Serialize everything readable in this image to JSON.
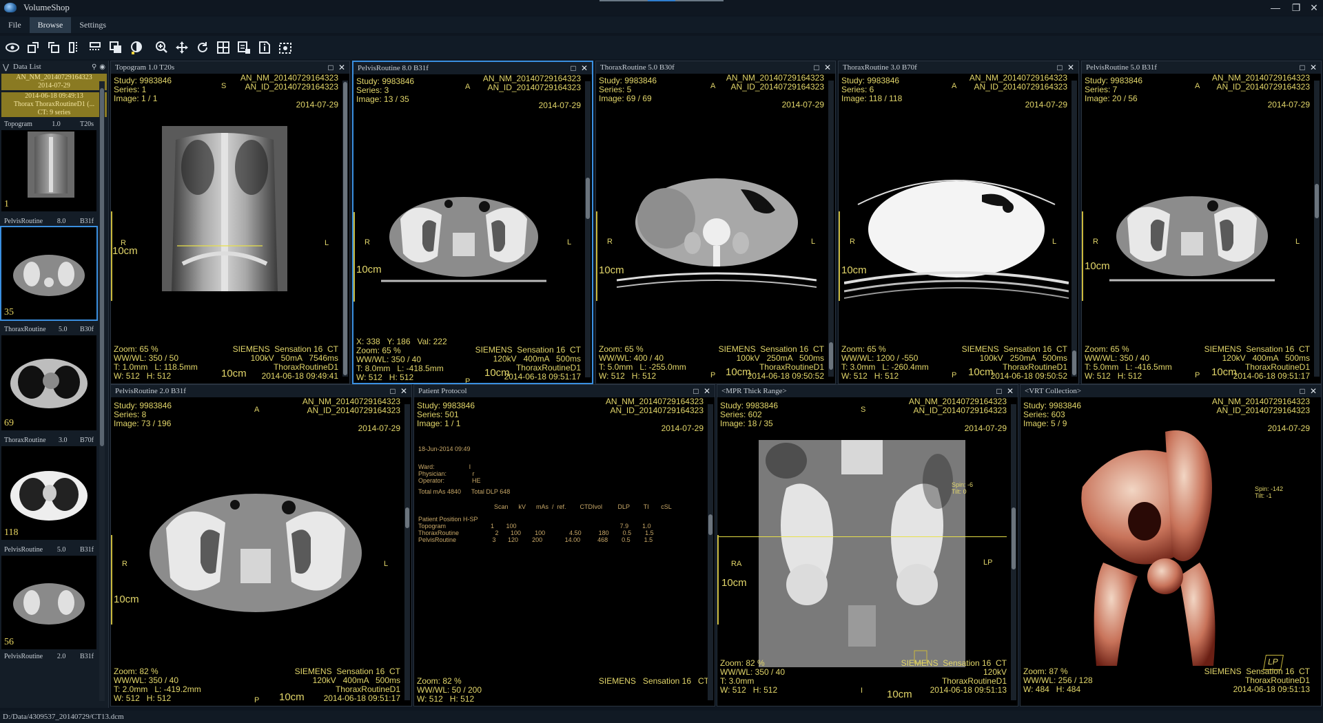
{
  "app": {
    "title": "VolumeShop"
  },
  "menu": {
    "items": [
      "File",
      "Browse",
      "Settings"
    ],
    "active": "Browse"
  },
  "toolbar": {
    "tools": [
      "eye-icon",
      "rotate-icon",
      "flip-icon",
      "mirror-icon",
      "slice-icon",
      "layers-icon",
      "contrast-icon",
      "zoom-icon",
      "pan-icon",
      "reset-icon",
      "grid-icon",
      "export-icon",
      "info-icon",
      "capture-icon"
    ]
  },
  "sidebar": {
    "title": "Data List",
    "study": {
      "id": "AN_NM_20140729164323",
      "date": "2014-07-29",
      "series_time": "2014-06-18 09:49:13",
      "desc": "Thorax ThoraxRoutineD1 (...",
      "count": "CT: 9 series"
    },
    "series": [
      {
        "name": "Topogram",
        "thick": "1.0",
        "kernel": "T20s",
        "count": "1"
      },
      {
        "name": "PelvisRoutine",
        "thick": "8.0",
        "kernel": "B31f",
        "count": "35"
      },
      {
        "name": "ThoraxRoutine",
        "thick": "5.0",
        "kernel": "B30f",
        "count": "69"
      },
      {
        "name": "ThoraxRoutine",
        "thick": "3.0",
        "kernel": "B70f",
        "count": "118"
      },
      {
        "name": "PelvisRoutine",
        "thick": "5.0",
        "kernel": "B31f",
        "count": "56"
      },
      {
        "name": "PelvisRoutine",
        "thick": "2.0",
        "kernel": "B31f",
        "count": ""
      }
    ]
  },
  "viewports": {
    "v1": {
      "title": "Topogram   1.0   T20s",
      "tl": "Study: 9983846\nSeries: 1\nImage: 1 / 1",
      "tr": "AN_NM_20140729164323\nAN_ID_20140729164323\n\n2014-07-29",
      "top": "S",
      "left": "R",
      "right": "L",
      "scale": "10cm",
      "bl": "Zoom: 65 %\nWW/WL: 350 / 50\nT: 1.0mm   L: 118.5mm\nW: 512   H: 512",
      "br": "SIEMENS  Sensation 16  CT\n100kV   50mA   7546ms\nThoraxRoutineD1\n2014-06-18 09:49:41",
      "bscale": "10cm"
    },
    "v2": {
      "title": "PelvisRoutine   8.0   B31f",
      "tl": "Study: 9983846\nSeries: 3\nImage: 13 / 35",
      "tr": "AN_NM_20140729164323\nAN_ID_20140729164323\n\n2014-07-29",
      "top": "A",
      "left": "R",
      "right": "L",
      "bottom": "P",
      "scale": "10cm",
      "bl": "X: 338   Y: 186   Val: 222\nZoom: 65 %\nWW/WL: 350 / 40\nT: 8.0mm   L: -418.5mm\nW: 512   H: 512",
      "br": "SIEMENS  Sensation 16  CT\n120kV   400mA   500ms\nThoraxRoutineD1\n2014-06-18 09:51:17",
      "bscale": "10cm"
    },
    "v3": {
      "title": "ThoraxRoutine   5.0   B30f",
      "tl": "Study: 9983846\nSeries: 5\nImage: 69 / 69",
      "tr": "AN_NM_20140729164323\nAN_ID_20140729164323\n\n2014-07-29",
      "top": "A",
      "left": "R",
      "right": "L",
      "bottom": "P",
      "scale": "10cm",
      "bl": "Zoom: 65 %\nWW/WL: 400 / 40\nT: 5.0mm   L: -255.0mm\nW: 512   H: 512",
      "br": "SIEMENS  Sensation 16  CT\n100kV   250mA   500ms\nThoraxRoutineD1\n2014-06-18 09:50:52",
      "bscale": "10cm"
    },
    "v4": {
      "title": "ThoraxRoutine   3.0   B70f",
      "tl": "Study: 9983846\nSeries: 6\nImage: 118 / 118",
      "tr": "AN_NM_20140729164323\nAN_ID_20140729164323\n\n2014-07-29",
      "top": "A",
      "left": "R",
      "right": "L",
      "bottom": "P",
      "scale": "10cm",
      "bl": "Zoom: 65 %\nWW/WL: 1200 / -550\nT: 3.0mm   L: -260.4mm\nW: 512   H: 512",
      "br": "SIEMENS  Sensation 16  CT\n100kV   250mA   500ms\nThoraxRoutineD1\n2014-06-18 09:50:52",
      "bscale": "10cm"
    },
    "v5": {
      "title": "PelvisRoutine   5.0   B31f",
      "tl": "Study: 9983846\nSeries: 7\nImage: 20 / 56",
      "tr": "AN_NM_20140729164323\nAN_ID_20140729164323\n\n2014-07-29",
      "top": "A",
      "left": "R",
      "right": "L",
      "bottom": "P",
      "scale": "10cm",
      "bl": "Zoom: 65 %\nWW/WL: 350 / 40\nT: 5.0mm   L: -416.5mm\nW: 512   H: 512",
      "br": "SIEMENS  Sensation 16  CT\n120kV   400mA   500ms\nThoraxRoutineD1\n2014-06-18 09:51:17",
      "bscale": "10cm"
    },
    "v6": {
      "title": "PelvisRoutine   2.0   B31f",
      "tl": "Study: 9983846\nSeries: 8\nImage: 73 / 196",
      "tr": "AN_NM_20140729164323\nAN_ID_20140729164323\n\n2014-07-29",
      "top": "A",
      "left": "R",
      "right": "L",
      "bottom": "P",
      "scale": "10cm",
      "bl": "Zoom: 82 %\nWW/WL: 350 / 40\nT: 2.0mm   L: -419.2mm\nW: 512   H: 512",
      "br": "SIEMENS  Sensation 16  CT\n120kV   400mA   500ms\nThoraxRoutineD1\n2014-06-18 09:51:17",
      "bscale": "10cm"
    },
    "v7": {
      "title": "Patient Protocol",
      "tl": "Study: 9983846\nSeries: 501\nImage: 1 / 1",
      "tr": "AN_NM_20140729164323\nAN_ID_20140729164323\n\n2014-07-29",
      "bl": "Zoom: 82 %\nWW/WL: 50 / 200\nW: 512   H: 512",
      "br": "SIEMENS   Sensation 16   CT",
      "protocol": {
        "date": "18-Jun-2014 09:49",
        "meta": "Ward:                    I\nPhysician:               r\nOperator:                HE",
        "totals": "Total mAs 4840      Total DLP 648",
        "header": "Scan      kV      mAs  /  ref.        CTDIvol         DLP        TI       cSL",
        "position": "Patient Position H-SP",
        "rows": "Topogram                          1       100                                                            7.9        1.0\nThoraxRoutine                     2       100        100              4.50          180        0.5        1.5\nPelvisRoutine                     3       120        200             14.00          468        0.5        1.5"
      }
    },
    "v8": {
      "title": "<MPR Thick Range>",
      "tl": "Study: 9983846\nSeries: 602\nImage: 18 / 35",
      "tr": "AN_NM_20140729164323\nAN_ID_20140729164323\n\n2014-07-29",
      "top": "S",
      "left": "RA",
      "right": "LP",
      "bottom": "I",
      "scale": "10cm",
      "angle": "Spin: -6\nTilt: 0",
      "bl": "Zoom: 82 %\nWW/WL: 350 / 40\nT: 3.0mm\nW: 512   H: 512",
      "br": "SIEMENS  Sensation 16  CT\n120kV\nThoraxRoutineD1\n2014-06-18 09:51:13",
      "bscale": "10cm"
    },
    "v9": {
      "title": "<VRT Collection>",
      "tl": "Study: 9983846\nSeries: 603\nImage: 5 / 9",
      "tr": "AN_NM_20140729164323\nAN_ID_20140729164323\n\n2014-07-29",
      "angle": "Spin: -142\nTilt: -1",
      "bl": "Zoom: 87 %\nWW/WL: 256 / 128\nW: 484   H: 484",
      "br": "SIEMENS  Sensation 16  CT\nThoraxRoutineD1\n2014-06-18 09:51:13",
      "orient_cube": "LP"
    }
  },
  "status": {
    "path": "D:/Data/4309537_20140729/CT13.dcm"
  }
}
